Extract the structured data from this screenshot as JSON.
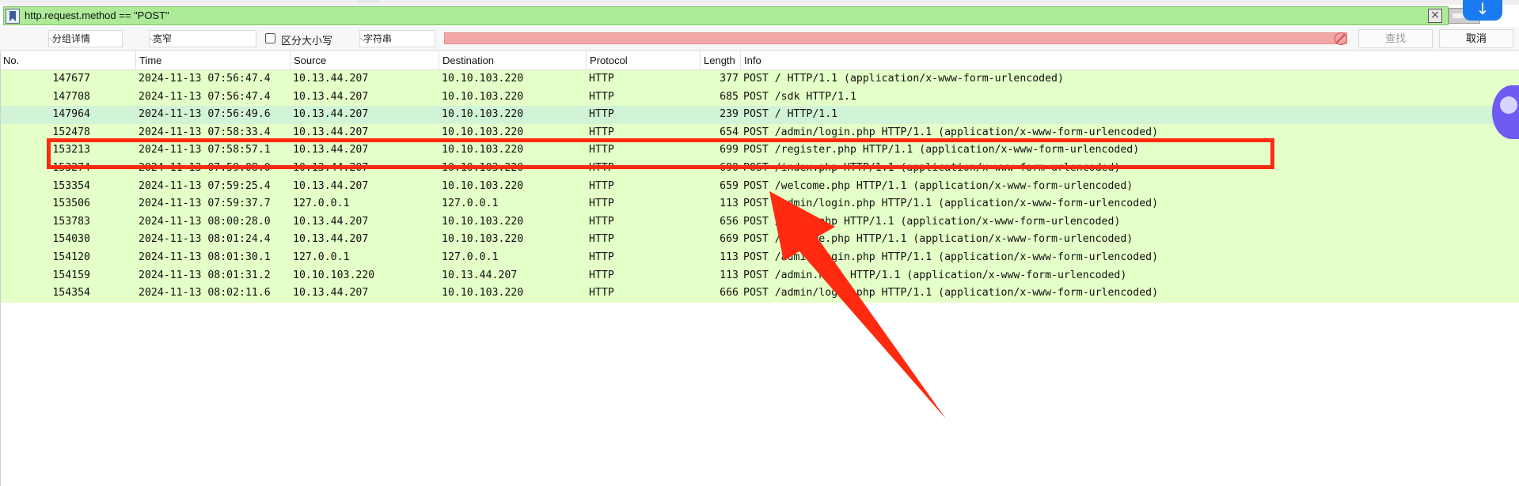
{
  "filter": {
    "expression": "http.request.method == \"POST\"",
    "clear_icon": "×",
    "download_icon": "↓"
  },
  "find": {
    "scope_label": "分组详情",
    "charset_label": "宽窄",
    "case_label": "区分大小写",
    "type_label": "字符串",
    "find_button": "查找",
    "cancel_button": "取消",
    "dropdown_arrow": "⌵"
  },
  "columns": {
    "no": "No.",
    "time": "Time",
    "source": "Source",
    "destination": "Destination",
    "protocol": "Protocol",
    "length": "Length",
    "info": "Info"
  },
  "packets": [
    {
      "no": "147677",
      "time": "2024-11-13 07:56:47.4",
      "src": "10.13.44.207",
      "dst": "10.10.103.220",
      "proto": "HTTP",
      "len": "377",
      "info": "POST / HTTP/1.1  (application/x-www-form-urlencoded)"
    },
    {
      "no": "147708",
      "time": "2024-11-13 07:56:47.4",
      "src": "10.13.44.207",
      "dst": "10.10.103.220",
      "proto": "HTTP",
      "len": "685",
      "info": "POST /sdk HTTP/1.1"
    },
    {
      "no": "147964",
      "time": "2024-11-13 07:56:49.6",
      "src": "10.13.44.207",
      "dst": "10.10.103.220",
      "proto": "HTTP",
      "len": "239",
      "info": "POST / HTTP/1.1"
    },
    {
      "no": "152478",
      "time": "2024-11-13 07:58:33.4",
      "src": "10.13.44.207",
      "dst": "10.10.103.220",
      "proto": "HTTP",
      "len": "654",
      "info": "POST /admin/login.php HTTP/1.1  (application/x-www-form-urlencoded)"
    },
    {
      "no": "153213",
      "time": "2024-11-13 07:58:57.1",
      "src": "10.13.44.207",
      "dst": "10.10.103.220",
      "proto": "HTTP",
      "len": "699",
      "info": "POST /register.php HTTP/1.1  (application/x-www-form-urlencoded)"
    },
    {
      "no": "153274",
      "time": "2024-11-13 07:59:08.0",
      "src": "10.13.44.207",
      "dst": "10.10.103.220",
      "proto": "HTTP",
      "len": "690",
      "info": "POST /index.php HTTP/1.1  (application/x-www-form-urlencoded)"
    },
    {
      "no": "153354",
      "time": "2024-11-13 07:59:25.4",
      "src": "10.13.44.207",
      "dst": "10.10.103.220",
      "proto": "HTTP",
      "len": "659",
      "info": "POST /welcome.php HTTP/1.1  (application/x-www-form-urlencoded)"
    },
    {
      "no": "153506",
      "time": "2024-11-13 07:59:37.7",
      "src": "127.0.0.1",
      "dst": "127.0.0.1",
      "proto": "HTTP",
      "len": "113",
      "info": "POST /admin/login.php HTTP/1.1  (application/x-www-form-urlencoded)"
    },
    {
      "no": "153783",
      "time": "2024-11-13 08:00:28.0",
      "src": "10.13.44.207",
      "dst": "10.10.103.220",
      "proto": "HTTP",
      "len": "656",
      "info": "POST /index.php HTTP/1.1  (application/x-www-form-urlencoded)"
    },
    {
      "no": "154030",
      "time": "2024-11-13 08:01:24.4",
      "src": "10.13.44.207",
      "dst": "10.10.103.220",
      "proto": "HTTP",
      "len": "669",
      "info": "POST /welcome.php HTTP/1.1  (application/x-www-form-urlencoded)"
    },
    {
      "no": "154120",
      "time": "2024-11-13 08:01:30.1",
      "src": "127.0.0.1",
      "dst": "127.0.0.1",
      "proto": "HTTP",
      "len": "113",
      "info": "POST /admin/login.php HTTP/1.1  (application/x-www-form-urlencoded)"
    },
    {
      "no": "154159",
      "time": "2024-11-13 08:01:31.2",
      "src": "10.10.103.220",
      "dst": "10.13.44.207",
      "proto": "HTTP",
      "len": "113",
      "info": "POST /admin.html HTTP/1.1  (application/x-www-form-urlencoded)"
    },
    {
      "no": "154354",
      "time": "2024-11-13 08:02:11.6",
      "src": "10.13.44.207",
      "dst": "10.10.103.220",
      "proto": "HTTP",
      "len": "666",
      "info": "POST /admin/login.php HTTP/1.1  (application/x-www-form-urlencoded)"
    }
  ],
  "colors": {
    "row_bg": "#e4ffc7",
    "selected_row_bg": "#d2f4d6",
    "filter_bg": "#adeb99",
    "annotation": "#ff2a10"
  }
}
